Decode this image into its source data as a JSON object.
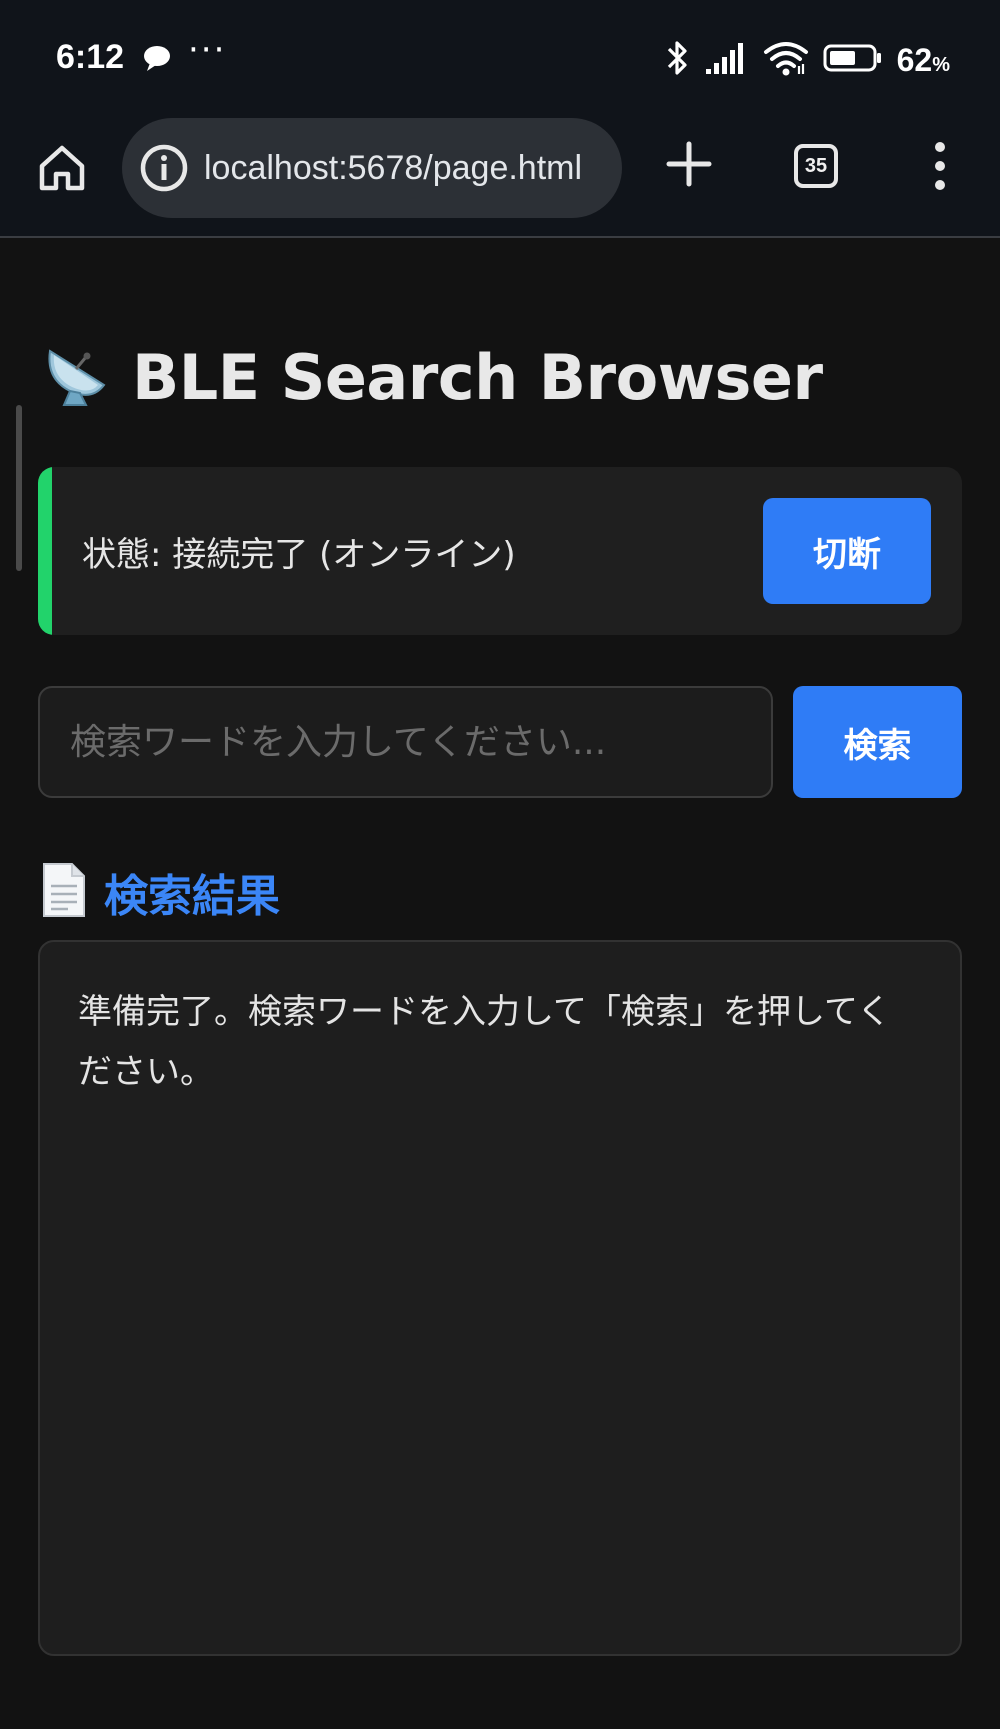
{
  "status_bar": {
    "time": "6:12",
    "more_dots": "···",
    "battery_percent": "62",
    "battery_unit": "%"
  },
  "browser": {
    "url": "localhost:5678/page.html",
    "tab_count": "35"
  },
  "page": {
    "title": "BLE Search Browser",
    "connection_status": "状態: 接続完了 (オンライン)",
    "disconnect_label": "切断",
    "search_placeholder": "検索ワードを入力してください...",
    "search_label": "検索",
    "results_heading": "検索結果",
    "results_text": "準備完了。検索ワードを入力して「検索」を押してください。"
  },
  "colors": {
    "accent_blue": "#2f7cf6",
    "status_green": "#22d36b",
    "heading_blue": "#3b86f7",
    "background": "#121212"
  },
  "icons": {
    "title_icon": "satellite-antenna-icon",
    "results_icon": "document-icon"
  }
}
